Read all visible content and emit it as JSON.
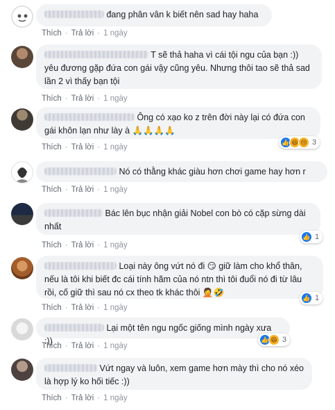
{
  "actions": {
    "like": "Thích",
    "reply": "Trả lời",
    "time": "1 ngày"
  },
  "comments": [
    {
      "text": "đang phân vân k biết nên sad hay haha",
      "reactions": null
    },
    {
      "text": "T sẽ thả haha vì cái tội ngu  của bạn :)) yêu đương  gặp đứa con gái vậy cũng yêu. Nhưng thôi tao sẽ thả sad lần 2 vì thấy bạn tội",
      "reactions": null
    },
    {
      "text": "Ông có xạo ko z trên đời này lại có đứa con gái khôn lạn như lày à 🙏🙏🙏🙏",
      "reactions": {
        "count": "3"
      }
    },
    {
      "text": "Nó có thằng khác giàu hơn chơi game hay hơn r",
      "reactions": null
    },
    {
      "text": "Bác lên bục nhận giải Nobel con bò có cặp sừng dài nhất",
      "reactions": {
        "count": "1"
      }
    },
    {
      "text": "Loại này ông vứt  nó đi 😏 giữ làm  cho khổ thân, nếu là tôi khi biết đc cái tính hãm  của nó ntn thì tôi đuổi  nó đi từ lâu rồi, cố giữ thì sau nó cx theo tk khác thôi 🤦🤣",
      "reactions": {
        "count": "1"
      }
    },
    {
      "text": "Lại một tên ngu ngốc giống mình ngày xưa :))",
      "reactions": {
        "count": "3"
      }
    },
    {
      "text": "Vứt ngay và luôn, xem game hơn mày thì cho nó xéo là hợp lý ko hối tiếc :))",
      "reactions": null
    }
  ]
}
